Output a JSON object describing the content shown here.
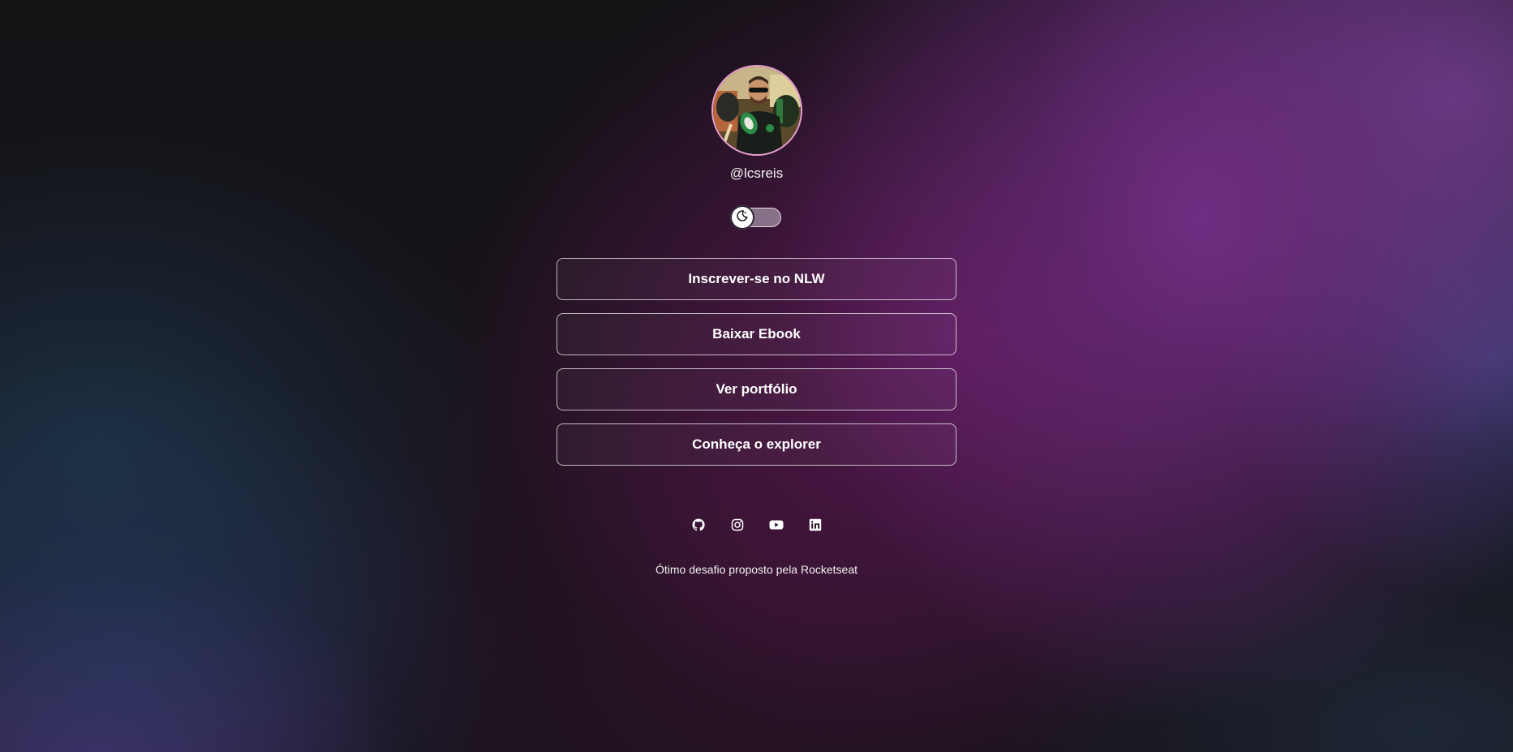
{
  "profile": {
    "username": "@lcsreis",
    "avatar_alt": "profile photo"
  },
  "theme_switch": {
    "icon": "moon-icon",
    "state": "dark"
  },
  "links": [
    {
      "label": "Inscrever-se no NLW"
    },
    {
      "label": "Baixar Ebook"
    },
    {
      "label": "Ver portfólio"
    },
    {
      "label": "Conheça o explorer"
    }
  ],
  "socials": [
    {
      "icon": "github-icon"
    },
    {
      "icon": "instagram-icon"
    },
    {
      "icon": "youtube-icon"
    },
    {
      "icon": "linkedin-icon"
    }
  ],
  "footer": {
    "text": "Ótimo desafio proposto pela Rocketseat"
  },
  "colors": {
    "accent_border": "#e6a0d0",
    "text": "#ffffff",
    "background_dark": "#131215",
    "background_purple": "#76308c"
  }
}
